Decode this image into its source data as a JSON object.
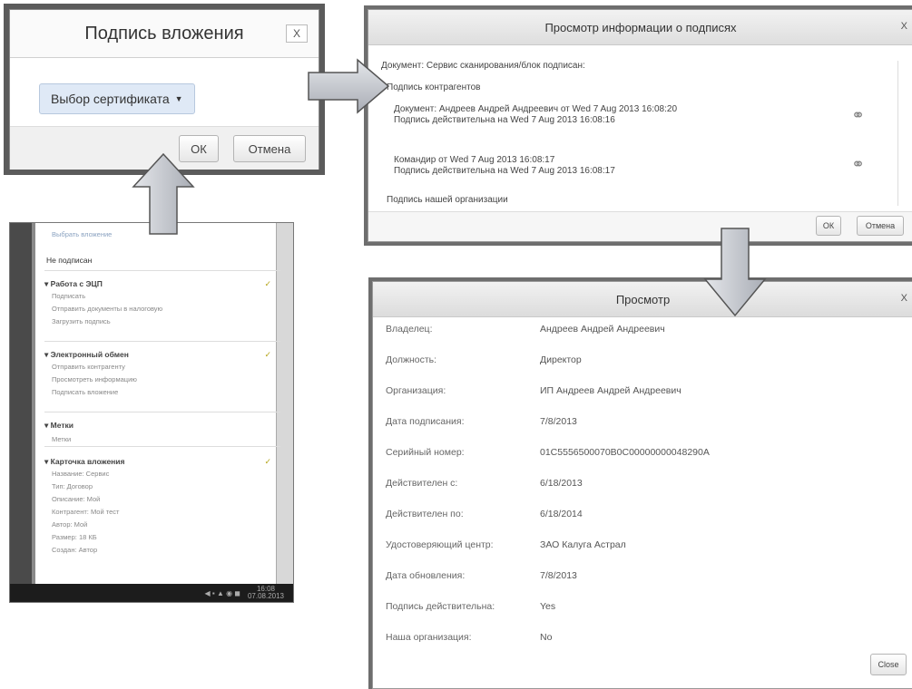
{
  "dialog_sign": {
    "title": "Подпись вложения",
    "close": "X",
    "cert_button": "Выбор сертификата",
    "ok": "ОК",
    "cancel": "Отмена"
  },
  "dialog_signinfo": {
    "title": "Просмотр информации о подписях",
    "close": "X",
    "document_line": "Документ: Сервис сканирования/блок подписан:",
    "contragent_sig": "Подпись контрагентов",
    "sig1_line1": "Документ: Андреев Андрей Андреевич от Wed 7 Aug 2013 16:08:20",
    "sig1_line2": "Подпись действительна на Wed 7 Aug 2013 16:08:16",
    "sig2_line1": "Командир от Wed 7 Aug 2013 16:08:17",
    "sig2_line2": "Подпись действительна на Wed 7 Aug 2013 16:08:17",
    "our_org_sig": "Подпись нашей организации",
    "ok": "ОК",
    "cancel": "Отмена"
  },
  "dialog_view": {
    "title": "Просмотр",
    "close": "X",
    "rows": [
      {
        "label": "Владелец:",
        "value": "Андреев Андрей Андреевич"
      },
      {
        "label": "Должность:",
        "value": "Директор"
      },
      {
        "label": "Организация:",
        "value": "ИП Андреев Андрей Андреевич"
      },
      {
        "label": "Дата подписания:",
        "value": "7/8/2013"
      },
      {
        "label": "Серийный номер:",
        "value": "01C5556500070B0C00000000048290A"
      },
      {
        "label": "Действителен с:",
        "value": "6/18/2013"
      },
      {
        "label": "Действителен по:",
        "value": "6/18/2014"
      },
      {
        "label": "Удостоверяющий центр:",
        "value": "ЗАО Калуга Астрал"
      },
      {
        "label": "Дата обновления:",
        "value": "7/8/2013"
      },
      {
        "label": "Подпись действительна:",
        "value": "Yes"
      },
      {
        "label": "Наша организация:",
        "value": "No"
      }
    ],
    "close_button": "Close"
  },
  "panel": {
    "top_link": "Выбрать вложение",
    "not_signed": "Не подписан",
    "sections": [
      {
        "title": "Работа с ЭЦП",
        "items": [
          "Подписать",
          "Отправить документы в налоговую",
          "Загрузить подпись"
        ]
      },
      {
        "title": "Электронный обмен",
        "items": [
          "Отправить контрагенту",
          "Просмотреть информацию",
          "Подписать вложение"
        ]
      },
      {
        "title": "Метки",
        "items": [
          "Метки"
        ]
      },
      {
        "title": "Карточка вложения",
        "items": [
          "Название: Сервис",
          "Тип: Договор",
          "Описание: Мой",
          "Контрагент: Мой тест",
          "Автор: Мой",
          "Размер: 18 КБ",
          "Создан: Автор"
        ]
      }
    ],
    "taskbar_time": "16:08",
    "taskbar_date": "07.08.2013"
  },
  "colors": {
    "dialog_frame": "#5b5b5b",
    "cert_button_bg": "#dfe9f6",
    "arrow_fill": "#c9ccd2",
    "check_color": "#b5a51b",
    "taskbar": "#1c1c1c"
  }
}
